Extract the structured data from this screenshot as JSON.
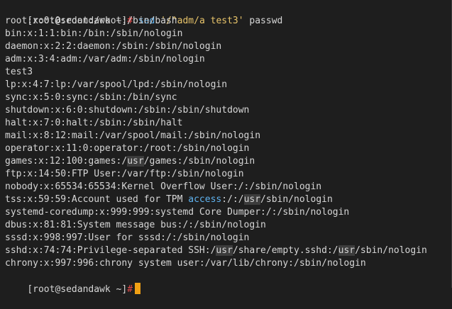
{
  "terminal": {
    "prompt": "[root@sedandawk ~]",
    "prompt_symbol": "#",
    "command": {
      "name": "sed",
      "script": "'/^adm/a test3'",
      "arg": "passwd"
    },
    "output_lines": [
      "root:x:0:0:root:/root:/bin/bash",
      "bin:x:1:1:bin:/bin:/sbin/nologin",
      "daemon:x:2:2:daemon:/sbin:/sbin/nologin",
      "adm:x:3:4:adm:/var/adm:/sbin/nologin",
      "test3",
      "lp:x:4:7:lp:/var/spool/lpd:/sbin/nologin",
      "sync:x:5:0:sync:/sbin:/bin/sync",
      "shutdown:x:6:0:shutdown:/sbin:/sbin/shutdown",
      "halt:x:7:0:halt:/sbin:/sbin/halt",
      "mail:x:8:12:mail:/var/spool/mail:/sbin/nologin",
      "operator:x:11:0:operator:/root:/sbin/nologin",
      "games:x:12:100:games:/usr/games:/sbin/nologin",
      "ftp:x:14:50:FTP User:/var/ftp:/sbin/nologin",
      "nobody:x:65534:65534:Kernel Overflow User:/:/sbin/nologin",
      "tss:x:59:59:Account used for TPM access:/:/usr/sbin/nologin",
      "systemd-coredump:x:999:999:systemd Core Dumper:/:/sbin/nologin",
      "dbus:x:81:81:System message bus:/:/sbin/nologin",
      "sssd:x:998:997:User for sssd:/:/sbin/nologin",
      "sshd:x:74:74:Privilege-separated SSH:/usr/share/empty.sshd:/usr/sbin/nologin",
      "chrony:x:997:996:chrony system user:/var/lib/chrony:/sbin/nologin"
    ],
    "final_prompt": "[root@sedandawk ~]",
    "final_prompt_symbol": "#",
    "colors": {
      "background": "#1e1e1e",
      "text": "#d6d6d6",
      "prompt_hash": "#e04848",
      "command_keyword": "#5fb3f0",
      "string": "#e8c46a",
      "cursor": "#f0a014",
      "highlight_bg": "#3c3c3c"
    }
  }
}
